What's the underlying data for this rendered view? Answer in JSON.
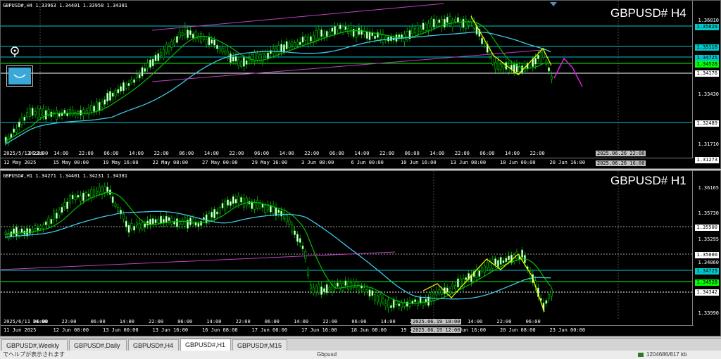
{
  "charts": {
    "h4": {
      "symbol_label": "GBPUSD#,H4  1.33963 1.34401 1.33958 1.34381",
      "title": "GBPUSD# H4",
      "price_labels": [
        "1.36010",
        "1.35820",
        "1.35116",
        "1.34725",
        "1.34528",
        "1.34176",
        "1.33430",
        "1.32489",
        "1.31710",
        "1.31273"
      ],
      "time_labels": [
        "12 May 2025",
        "15 May 00:00",
        "19 May 16:00",
        "22 May 08:00",
        "27 May 00:00",
        "29 May 16:00",
        "3 Jun 08:00",
        "6 Jun 00:00",
        "10 Jun 16:00",
        "13 Jun 08:00",
        "18 Jun 00:00",
        "20 Jun 16:00"
      ],
      "grid_time_labels": [
        "2025/5/12 22:00",
        "06:00",
        "14:00",
        "22:00",
        "06:00",
        "14:00",
        "22:00",
        "06:00",
        "14:00",
        "22:00",
        "06:00",
        "14:00",
        "22:00",
        "06:00",
        "14:00",
        "22:00",
        "06:00",
        "14:00",
        "22:00",
        "06:00",
        "14:00",
        "22:00"
      ],
      "time_tags": [
        "2025.06.26 22:00",
        "2025.06.26 16:00"
      ]
    },
    "h1": {
      "symbol_label": "GBPUSD#,H1  1.34271 1.34401 1.34231 1.34381",
      "title": "GBPUSD# H1",
      "price_labels": [
        "1.36165",
        "1.35730",
        "1.35500",
        "1.35295",
        "1.35000",
        "1.34860",
        "1.34725",
        "1.34528",
        "1.34342",
        "1.33990"
      ],
      "time_labels": [
        "11 Jun 2025",
        "12 Jun 08:00",
        "13 Jun 00:00",
        "13 Jun 16:00",
        "16 Jun 08:00",
        "17 Jun 00:00",
        "17 Jun 16:00",
        "18 Jun 08:00",
        "19 Jun 00:00",
        "19 Jun 16:00",
        "20 Jun 08:00",
        "23 Jun 00:00"
      ],
      "grid_time_labels": [
        "2025/6/11 06:00",
        "14:00",
        "22:00",
        "06:00",
        "14:00",
        "22:00",
        "06:00",
        "14:00",
        "22:00",
        "06:00",
        "14:00",
        "22:00",
        "06:00",
        "14:00",
        "22:00",
        "06:00",
        "14:00",
        "22:00",
        "06:00"
      ],
      "time_tags": [
        "2025.06.19 18:00",
        "2025.06.19 12:00"
      ]
    }
  },
  "tabs": [
    {
      "label": "GBPUSD#,Weekly",
      "active": false
    },
    {
      "label": "GBPUSD#,Daily",
      "active": false
    },
    {
      "label": "GBPUSD#,H4",
      "active": false
    },
    {
      "label": "GBPUSD#,H1",
      "active": true
    },
    {
      "label": "GBPUSD#,M15",
      "active": false
    }
  ],
  "status": {
    "help_text": "でヘルプが表示されます",
    "profile": "Gbpusd",
    "traffic": "1204686/817 kb"
  },
  "colors": {
    "background": "#000000",
    "bull_candle": "#ffffff",
    "ma_fast": "#00c000",
    "ma_slow": "#40c8e8",
    "trendline": "#c040c0",
    "zigzag": "#ffff00",
    "projection": "#e020e0",
    "level_cyan": "#00c8c8",
    "level_green": "#00ff00"
  },
  "icons": [
    "pen-icon",
    "object-icon",
    "scroll-down-icon"
  ]
}
